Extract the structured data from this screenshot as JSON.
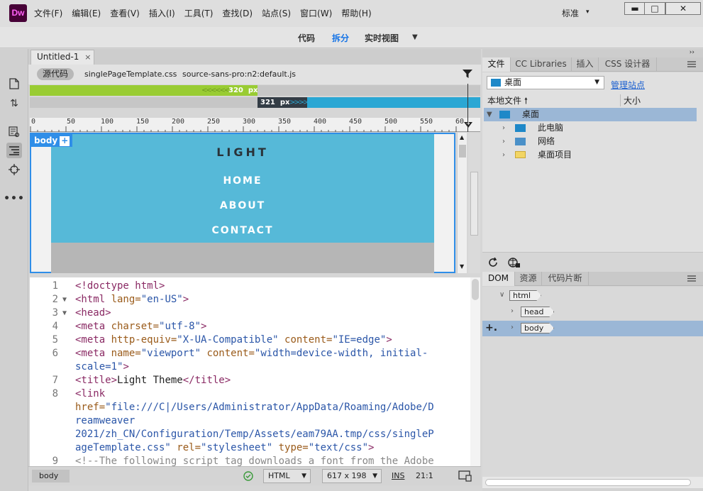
{
  "app": {
    "logo": "Dw",
    "menus": [
      "文件(F)",
      "编辑(E)",
      "查看(V)",
      "插入(I)",
      "工具(T)",
      "查找(D)",
      "站点(S)",
      "窗口(W)",
      "帮助(H)"
    ],
    "workspace": "标准"
  },
  "viewbar": {
    "code": "代码",
    "split": "拆分",
    "live": "实时视图",
    "accent": "#1473e6"
  },
  "document": {
    "tab_title": "Untitled-1",
    "close": "×",
    "source_code": "源代码",
    "related_files": [
      "singlePageTemplate.css",
      "source-sans-pro:n2:default.js"
    ]
  },
  "media_queries": {
    "max_label": "320",
    "min_label": "321",
    "unit": "px",
    "max_color": "#99cc33",
    "min_color": "#2aa7d4"
  },
  "ruler": {
    "labels": [
      "0",
      "50",
      "100",
      "150",
      "200",
      "250",
      "300",
      "350",
      "400",
      "450",
      "500",
      "550",
      "60"
    ]
  },
  "live_view": {
    "element_tag": "body",
    "add": "+",
    "site_title": "LIGHT",
    "nav": [
      "HOME",
      "ABOUT",
      "CONTACT"
    ],
    "header_color": "#56b9d8"
  },
  "code": {
    "lines": [
      {
        "num": "1",
        "fold": "",
        "parts": [
          {
            "c": "tag",
            "t": "<!doctype html>"
          }
        ]
      },
      {
        "num": "2",
        "fold": "▼",
        "parts": [
          {
            "c": "tag",
            "t": "<html "
          },
          {
            "c": "attr",
            "t": "lang="
          },
          {
            "c": "val",
            "t": "\"en-US\""
          },
          {
            "c": "tag",
            "t": ">"
          }
        ]
      },
      {
        "num": "3",
        "fold": "▼",
        "parts": [
          {
            "c": "tag",
            "t": "<head>"
          }
        ]
      },
      {
        "num": "4",
        "fold": "",
        "parts": [
          {
            "c": "tag",
            "t": "<meta "
          },
          {
            "c": "attr",
            "t": "charset="
          },
          {
            "c": "val",
            "t": "\"utf-8\""
          },
          {
            "c": "tag",
            "t": ">"
          }
        ]
      },
      {
        "num": "5",
        "fold": "",
        "parts": [
          {
            "c": "tag",
            "t": "<meta "
          },
          {
            "c": "attr",
            "t": "http-equiv="
          },
          {
            "c": "val",
            "t": "\"X-UA-Compatible\" "
          },
          {
            "c": "attr",
            "t": "content="
          },
          {
            "c": "val",
            "t": "\"IE=edge\""
          },
          {
            "c": "tag",
            "t": ">"
          }
        ]
      },
      {
        "num": "6",
        "fold": "",
        "parts": [
          {
            "c": "tag",
            "t": "<meta "
          },
          {
            "c": "attr",
            "t": "name="
          },
          {
            "c": "val",
            "t": "\"viewport\" "
          },
          {
            "c": "attr",
            "t": "content="
          },
          {
            "c": "val",
            "t": "\"width=device-width, initial-"
          }
        ]
      },
      {
        "num": "",
        "fold": "",
        "parts": [
          {
            "c": "val",
            "t": "scale=1\""
          },
          {
            "c": "tag",
            "t": ">"
          }
        ]
      },
      {
        "num": "7",
        "fold": "",
        "parts": [
          {
            "c": "tag",
            "t": "<title>"
          },
          {
            "c": "txt",
            "t": "Light Theme"
          },
          {
            "c": "tag",
            "t": "</title>"
          }
        ]
      },
      {
        "num": "8",
        "fold": "",
        "parts": [
          {
            "c": "tag",
            "t": "<link"
          }
        ]
      },
      {
        "num": "",
        "fold": "",
        "parts": [
          {
            "c": "attr",
            "t": "href="
          },
          {
            "c": "val",
            "t": "\"file:///C|/Users/Administrator/AppData/Roaming/Adobe/D"
          }
        ]
      },
      {
        "num": "",
        "fold": "",
        "parts": [
          {
            "c": "val",
            "t": "reamweaver"
          }
        ]
      },
      {
        "num": "",
        "fold": "",
        "parts": [
          {
            "c": "val",
            "t": "2021/zh_CN/Configuration/Temp/Assets/eam79AA.tmp/css/singleP"
          }
        ]
      },
      {
        "num": "",
        "fold": "",
        "parts": [
          {
            "c": "val",
            "t": "ageTemplate.css\" "
          },
          {
            "c": "attr",
            "t": "rel="
          },
          {
            "c": "val",
            "t": "\"stylesheet\" "
          },
          {
            "c": "attr",
            "t": "type="
          },
          {
            "c": "val",
            "t": "\"text/css\""
          },
          {
            "c": "tag",
            "t": ">"
          }
        ]
      },
      {
        "num": "9",
        "fold": "",
        "parts": [
          {
            "c": "cmt",
            "t": "<!--The following script tag downloads a font from the Adobe"
          }
        ]
      }
    ]
  },
  "status": {
    "tag": "body",
    "doc_type": "HTML",
    "window_size": "617 x 198",
    "mode": "INS",
    "cursor": "21:1"
  },
  "files_panel": {
    "tabs": [
      "文件",
      "CC Libraries",
      "插入",
      "CSS 设计器"
    ],
    "site": "桌面",
    "manage": "管理站点",
    "col_local": "本地文件",
    "col_size": "大小",
    "tree": [
      {
        "label": "桌面",
        "toggle": "▼",
        "level": 0,
        "icon": "desktop-icon",
        "color": "#1e88c8"
      },
      {
        "label": "此电脑",
        "toggle": "›",
        "level": 1,
        "icon": "computer-icon",
        "color": "#1e88c8"
      },
      {
        "label": "网络",
        "toggle": "›",
        "level": 1,
        "icon": "network-icon",
        "color": "#4a90c8"
      },
      {
        "label": "桌面项目",
        "toggle": "›",
        "level": 1,
        "icon": "folder-icon",
        "color": "#f2d564"
      }
    ]
  },
  "dom_panel": {
    "tabs": [
      "DOM",
      "资源",
      "代码片断"
    ],
    "nodes": [
      {
        "tag": "html",
        "toggle": "∨",
        "level": 0
      },
      {
        "tag": "head",
        "toggle": "›",
        "level": 1
      },
      {
        "tag": "body",
        "toggle": "›",
        "level": 1
      }
    ],
    "add": "+."
  }
}
